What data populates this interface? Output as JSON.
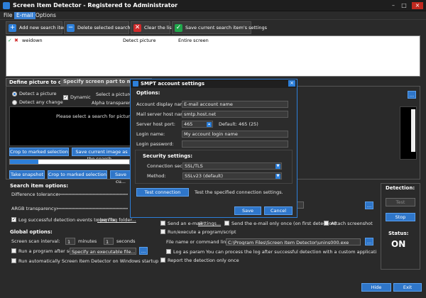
{
  "window": {
    "title": "Screen Item Detector - Registered to Administrator",
    "min": "–",
    "max": "□",
    "close": "×"
  },
  "menu": [
    "File",
    "E-mail",
    "Options"
  ],
  "toolbar": {
    "add": "Add new search item",
    "delete": "Delete selected search item",
    "clear": "Clear the list",
    "save": "Save current search item's settings"
  },
  "list": {
    "row": {
      "name": "weidown",
      "type": "Detect picture",
      "area": "Entire screen"
    }
  },
  "tabs": {
    "define": "Define picture to detect",
    "specify": "Specify screen part to monitor"
  },
  "define": {
    "detect_picture": "Detect a picture",
    "detect_change": "Detect any change",
    "dynamic": "Dynamic",
    "select_file": "Select a picture file",
    "alpha": "Alpha transparent image",
    "search_msg": "Please select a search for picture or snapshot",
    "crop": "Crop to marked selection",
    "save_search": "Save current image as the search...",
    "snapshot": "Take snapshot",
    "crop2": "Crop to marked selection",
    "save2": "Save cu..."
  },
  "search_options": {
    "title": "Search item options:",
    "diff": "Difference tolerance:",
    "argb": "ARGB transparency:",
    "log": "Log successful detection events to log file",
    "open_log": "open log folder..."
  },
  "global": {
    "title": "Global options:",
    "interval": "Screen scan interval:",
    "minutes_val": "1",
    "minutes": "minutes",
    "seconds_val": "1",
    "seconds": "seconds",
    "run_after": "Run a program after scan:",
    "exe_placeholder": "Specify an executable file...",
    "run_startup": "Run automatically Screen Item Detector on Windows startup"
  },
  "actions": {
    "send_email": "Send an e-mail",
    "settings": "settings...",
    "send_once": "Send the e-mail only once (on first detection)",
    "attach": "Attach screenshot",
    "run_program": "Run/execute a program/script",
    "filename_label": "File name or command line:",
    "filename": "C:\\Program Files\\Screen Item Detector\\unins000.exe",
    "log_param": "Log as param",
    "log_param_desc": "You can process the log after successful detection with a custom application. The log file name is passed",
    "report_once": "Report the detection only once"
  },
  "detection": {
    "title": "Detection:",
    "test": "Test",
    "stop": "Stop",
    "status_title": "Status:",
    "status": "ON"
  },
  "bottom": {
    "hide": "Hide",
    "exit": "Exit"
  },
  "dialog": {
    "title": "SMPT account settings",
    "options": "Options:",
    "display_label": "Account display name:",
    "display": "E-mail account name",
    "host_label": "Mail server host name:",
    "host": "smtp.host.net",
    "port_label": "Server host port:",
    "port": "465",
    "port_default": "Default: 465 (25)",
    "login_label": "Login name:",
    "login": "My account login name",
    "pass_label": "Login password:",
    "pass": "",
    "security_title": "Security settings:",
    "conn_label": "Connection security:",
    "conn": "SSL/TLS",
    "method_label": "Method:",
    "method": "SSLv23 (default)",
    "test_btn": "Test connection",
    "test_desc": "Test the specified connection settings.",
    "save": "Save",
    "cancel": "Cancel",
    "close": "×"
  },
  "colors": {
    "accent": "#2d7fd9",
    "close": "#c02a20",
    "green": "#1fa64a",
    "red": "#d02a2a"
  }
}
